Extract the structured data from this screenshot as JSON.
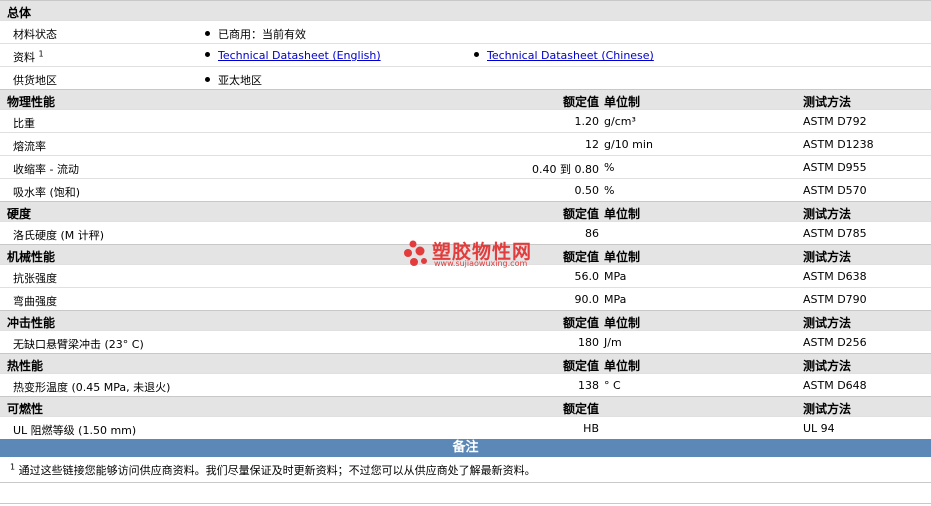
{
  "general": {
    "title": "总体",
    "rows": [
      {
        "label": "材料状态",
        "items": [
          "已商用：当前有效"
        ]
      },
      {
        "label": "资料",
        "sup": "1",
        "links": [
          "Technical Datasheet (English)",
          "Technical Datasheet (Chinese)"
        ]
      },
      {
        "label": "供货地区",
        "items": [
          "亚太地区"
        ]
      }
    ]
  },
  "sections": [
    {
      "title": "物理性能",
      "h_value": "额定值",
      "h_unit": "单位制",
      "h_method": "测试方法",
      "rows": [
        {
          "label": "比重",
          "value": "1.20",
          "unit": "g/cm³",
          "method": "ASTM D792"
        },
        {
          "label": "熔流率",
          "value": "12",
          "unit": "g/10 min",
          "method": "ASTM D1238"
        },
        {
          "label": "收缩率 - 流动",
          "value": "0.40 到 0.80",
          "unit": "%",
          "method": "ASTM D955"
        },
        {
          "label": "吸水率 (饱和)",
          "value": "0.50",
          "unit": "%",
          "method": "ASTM D570"
        }
      ]
    },
    {
      "title": "硬度",
      "h_value": "额定值",
      "h_unit": "单位制",
      "h_method": "测试方法",
      "rows": [
        {
          "label": "洛氏硬度 (M 计秤)",
          "value": "86",
          "unit": "",
          "method": "ASTM D785"
        }
      ]
    },
    {
      "title": "机械性能",
      "h_value": "额定值",
      "h_unit": "单位制",
      "h_method": "测试方法",
      "rows": [
        {
          "label": "抗张强度",
          "value": "56.0",
          "unit": "MPa",
          "method": "ASTM D638"
        },
        {
          "label": "弯曲强度",
          "value": "90.0",
          "unit": "MPa",
          "method": "ASTM D790"
        }
      ]
    },
    {
      "title": "冲击性能",
      "h_value": "额定值",
      "h_unit": "单位制",
      "h_method": "测试方法",
      "rows": [
        {
          "label": "无缺口悬臂梁冲击 (23° C)",
          "value": "180",
          "unit": "J/m",
          "method": "ASTM D256"
        }
      ]
    },
    {
      "title": "热性能",
      "h_value": "额定值",
      "h_unit": "单位制",
      "h_method": "测试方法",
      "rows": [
        {
          "label": "热变形温度 (0.45 MPa, 未退火)",
          "value": "138",
          "unit": "° C",
          "method": "ASTM D648"
        }
      ]
    },
    {
      "title": "可燃性",
      "h_value": "额定值",
      "h_unit": "",
      "h_method": "测试方法",
      "rows": [
        {
          "label": "UL 阻燃等级 (1.50 mm)",
          "value": "HB",
          "unit": "",
          "method": "UL 94"
        }
      ]
    }
  ],
  "notes": {
    "title": "备注",
    "sup": "1",
    "text": "通过这些链接您能够访问供应商资料。我们尽量保证及时更新资料；不过您可以从供应商处了解最新资料。"
  },
  "watermark": {
    "name": "塑胶物性网",
    "url": "www.sujiaowuxing.com"
  }
}
